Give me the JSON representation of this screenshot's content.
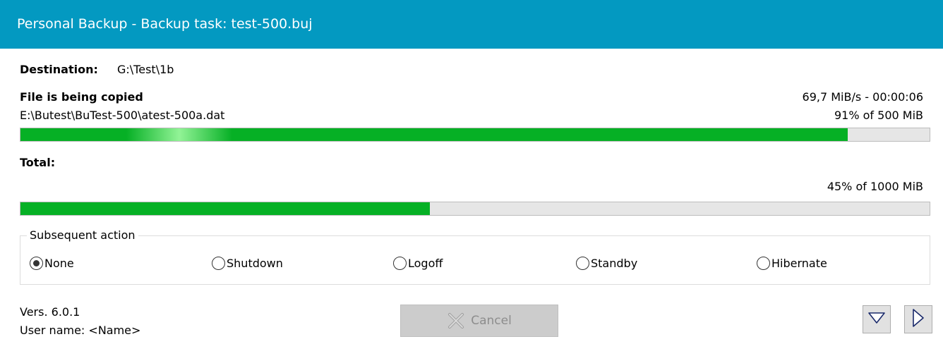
{
  "window": {
    "title": "Personal Backup - Backup task: test-500.buj"
  },
  "destination": {
    "label": "Destination:",
    "value": "G:\\Test\\1b"
  },
  "file": {
    "status": "File is being copied",
    "speed_time": "69,7 MiB/s - 00:00:06",
    "path": "E:\\Butest\\BuTest-500\\atest-500a.dat",
    "progress_text": "91% of 500 MiB",
    "progress": 0.91
  },
  "total": {
    "label": "Total:",
    "progress_text": "45% of 1000 MiB",
    "progress": 0.45
  },
  "subsequent_action": {
    "title": "Subsequent action",
    "options": [
      "None",
      "Shutdown",
      "Logoff",
      "Standby",
      "Hibernate"
    ],
    "selected": "None"
  },
  "footer": {
    "version": "Vers. 6.0.1",
    "user": "User name: <Name>",
    "cancel_label": "Cancel"
  },
  "colors": {
    "titlebar": "#0399c1",
    "progress_fill": "#06b025",
    "progress_track": "#e6e6e6"
  },
  "icons": [
    "cancel-x-icon",
    "triangle-down-icon",
    "triangle-right-icon"
  ]
}
